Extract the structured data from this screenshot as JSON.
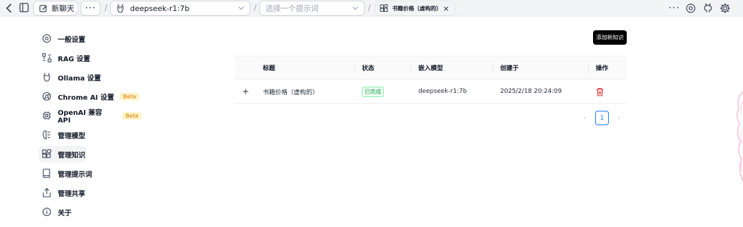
{
  "topbar": {
    "new_chat_label": "新聊天",
    "model_select_value": "deepseek-r1:7b",
    "prompt_select_placeholder": "选择一个提示词",
    "knowledge_tab_label": "书籍价格（虚构的）",
    "tab_close": "×"
  },
  "sidebar": {
    "items": [
      {
        "label": "一般设置",
        "icon": "gear-icon"
      },
      {
        "label": "RAG 设置",
        "icon": "rag-icon"
      },
      {
        "label": "Ollama 设置",
        "icon": "llama-icon"
      },
      {
        "label": "Chrome AI 设置",
        "icon": "chrome-icon",
        "badge": "Beta"
      },
      {
        "label": "OpenAI 兼容 API",
        "icon": "chip-icon",
        "badge": "Beta"
      },
      {
        "label": "管理模型",
        "icon": "brain-icon"
      },
      {
        "label": "管理知识",
        "icon": "blocks-icon"
      },
      {
        "label": "管理提示词",
        "icon": "book-icon"
      },
      {
        "label": "管理共享",
        "icon": "share-icon"
      },
      {
        "label": "关于",
        "icon": "info-icon"
      }
    ]
  },
  "main": {
    "add_button_label": "添加新知识",
    "table": {
      "headers": {
        "title": "标题",
        "status": "状态",
        "model": "嵌入模型",
        "created": "创建于",
        "actions": "操作"
      },
      "rows": [
        {
          "expand": "+",
          "title": "书籍价格（虚构的）",
          "status": "已完成",
          "model": "deepseek-r1:7b",
          "created": "2025/2/18 20:24:09"
        }
      ]
    },
    "pagination": {
      "prev": "‹",
      "current": "1",
      "next": "›"
    }
  },
  "colors": {
    "accent": "#1677ff",
    "danger": "#dc2626",
    "success": "#16a34a",
    "beta": "#d97706"
  }
}
